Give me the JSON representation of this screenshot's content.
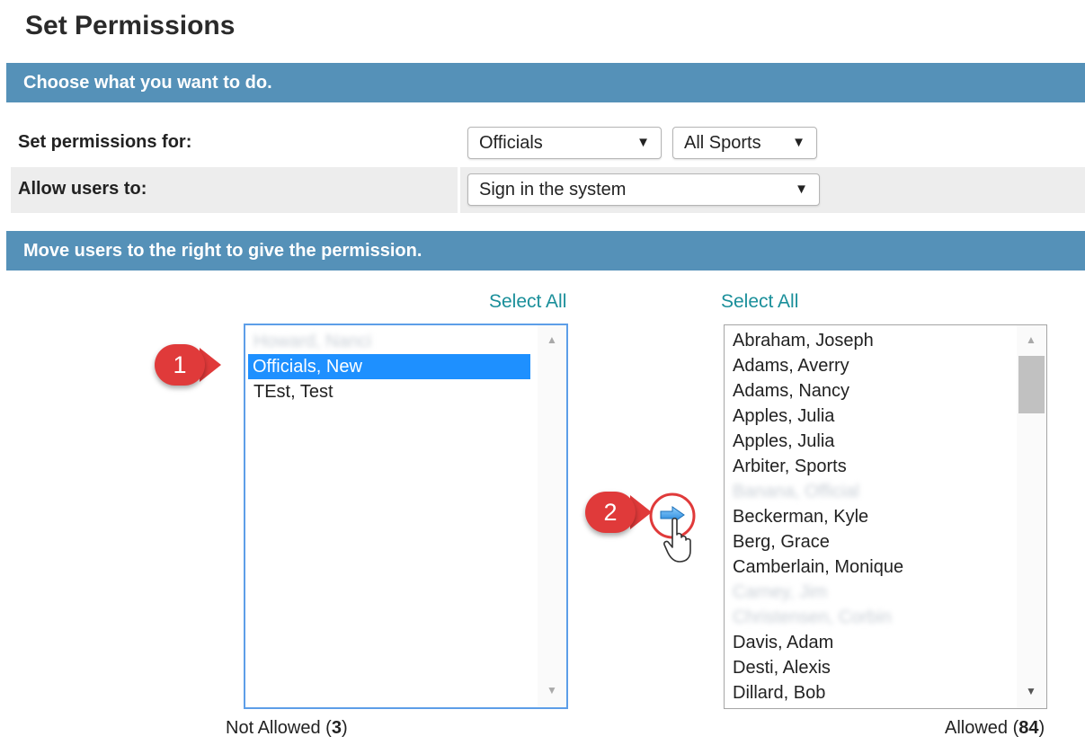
{
  "page": {
    "title": "Set Permissions"
  },
  "sections": {
    "choose": "Choose what you want to do.",
    "move": "Move users to the right to give the permission."
  },
  "form": {
    "set_permissions_label": "Set permissions for:",
    "allow_users_label": "Allow users to:",
    "group_select": {
      "value": "Officials"
    },
    "sport_select": {
      "value": "All Sports"
    },
    "action_select": {
      "value": "Sign in the system"
    }
  },
  "left_list": {
    "select_all": "Select All",
    "items": [
      {
        "label": "Howard, Nanci",
        "blurred": true
      },
      {
        "label": "Officials, New",
        "selected": true
      },
      {
        "label": "TEst, Test"
      }
    ],
    "footer_label": "Not Allowed (",
    "count": "3",
    "footer_close": ")"
  },
  "right_list": {
    "select_all": "Select All",
    "items": [
      "Abraham, Joseph",
      "Adams, Averry",
      "Adams, Nancy",
      "Apples, Julia",
      "Apples, Julia",
      "Arbiter, Sports",
      "Banana, Official",
      "Beckerman, Kyle",
      "Berg, Grace",
      "Camberlain, Monique",
      "Carney, Jim",
      "Christensen, Corbin",
      "Davis, Adam",
      "Desti, Alexis",
      "Dillard, Bob"
    ],
    "blurred_indices": [
      6,
      10,
      11
    ],
    "footer_label": "Allowed (",
    "count": "84",
    "footer_close": ")"
  },
  "annotations": {
    "step1": "1",
    "step2": "2"
  },
  "colors": {
    "section_bar": "#5591b8",
    "link": "#1a8f9a",
    "selection": "#1e90ff",
    "callout": "#e03a3a"
  }
}
